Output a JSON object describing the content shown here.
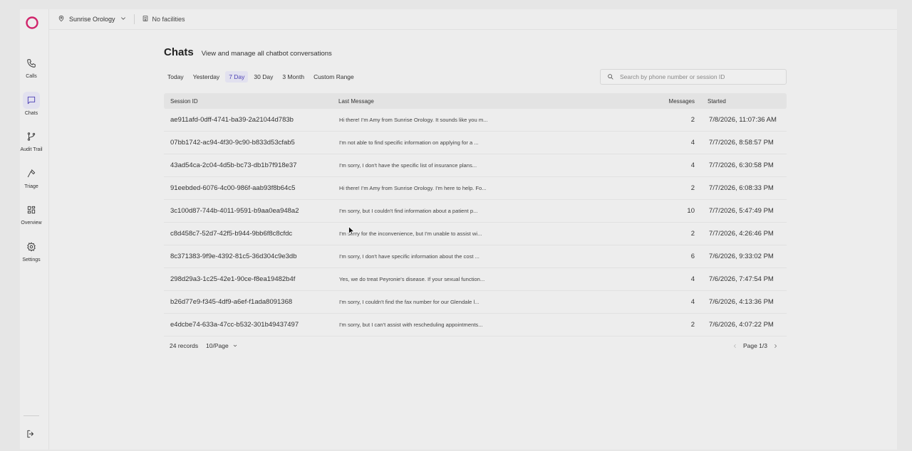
{
  "brand": {
    "accent_color": "#d0246b",
    "active_color": "#4b3fb3"
  },
  "sidebar": {
    "items": [
      {
        "label": "Calls",
        "icon": "phone-icon",
        "active": false
      },
      {
        "label": "Chats",
        "icon": "chat-icon",
        "active": true
      },
      {
        "label": "Audit Trail",
        "icon": "branch-icon",
        "active": false
      },
      {
        "label": "Triage",
        "icon": "hammer-icon",
        "active": false
      },
      {
        "label": "Overview",
        "icon": "grid-icon",
        "active": false
      },
      {
        "label": "Settings",
        "icon": "gear-icon",
        "active": false
      }
    ],
    "logout_icon": "logout-icon"
  },
  "topbar": {
    "location": "Sunrise Orology",
    "facilities": "No facilities"
  },
  "page": {
    "title": "Chats",
    "subtitle": "View and manage all chatbot conversations"
  },
  "filters": [
    {
      "label": "Today",
      "active": false
    },
    {
      "label": "Yesterday",
      "active": false
    },
    {
      "label": "7 Day",
      "active": true
    },
    {
      "label": "30 Day",
      "active": false
    },
    {
      "label": "3 Month",
      "active": false
    },
    {
      "label": "Custom Range",
      "active": false
    }
  ],
  "search": {
    "placeholder": "Search by phone number or session ID",
    "value": ""
  },
  "table": {
    "columns": {
      "session_id": "Session ID",
      "last_message": "Last Message",
      "messages": "Messages",
      "started": "Started"
    },
    "rows": [
      {
        "session_id": "ae911afd-0dff-4741-ba39-2a21044d783b",
        "last_message": "Hi there! I'm Amy from Sunrise Orology. It sounds like you m...",
        "messages": "2",
        "started": "7/8/2026, 11:07:36 AM"
      },
      {
        "session_id": "07bb1742-ac94-4f30-9c90-b833d53cfab5",
        "last_message": "I'm not able to find specific information on applying for a ...",
        "messages": "4",
        "started": "7/7/2026, 8:58:57 PM"
      },
      {
        "session_id": "43ad54ca-2c04-4d5b-bc73-db1b7f918e37",
        "last_message": "I'm sorry, I don't have the specific list of insurance plans...",
        "messages": "4",
        "started": "7/7/2026, 6:30:58 PM"
      },
      {
        "session_id": "91eebded-6076-4c00-986f-aab93f8b64c5",
        "last_message": "Hi there! I'm Amy from Sunrise Orology. I'm here to help. Fo...",
        "messages": "2",
        "started": "7/7/2026, 6:08:33 PM"
      },
      {
        "session_id": "3c100d87-744b-4011-9591-b9aa0ea948a2",
        "last_message": "I'm sorry, but I couldn't find information about a patient p...",
        "messages": "10",
        "started": "7/7/2026, 5:47:49 PM"
      },
      {
        "session_id": "c8d458c7-52d7-42f5-b944-9bb6f8c8cfdc",
        "last_message": "I'm sorry for the inconvenience, but I'm unable to assist wi...",
        "messages": "2",
        "started": "7/7/2026, 4:26:46 PM"
      },
      {
        "session_id": "8c371383-9f9e-4392-81c5-36d304c9e3db",
        "last_message": "I'm sorry, I don't have specific information about the cost ...",
        "messages": "6",
        "started": "7/6/2026, 9:33:02 PM"
      },
      {
        "session_id": "298d29a3-1c25-42e1-90ce-f8ea19482b4f",
        "last_message": "Yes, we do treat Peyronie's disease. If your sexual function...",
        "messages": "4",
        "started": "7/6/2026, 7:47:54 PM"
      },
      {
        "session_id": "b26d77e9-f345-4df9-a6ef-f1ada8091368",
        "last_message": "I'm sorry, I couldn't find the fax number for our Glendale l...",
        "messages": "4",
        "started": "7/6/2026, 4:13:36 PM"
      },
      {
        "session_id": "e4dcbe74-633a-47cc-b532-301b49437497",
        "last_message": "I'm sorry, but I can't assist with rescheduling appointments...",
        "messages": "2",
        "started": "7/6/2026, 4:07:22 PM"
      }
    ]
  },
  "footer": {
    "records": "24 records",
    "per_page": "10/Page",
    "page": "Page 1/3"
  }
}
